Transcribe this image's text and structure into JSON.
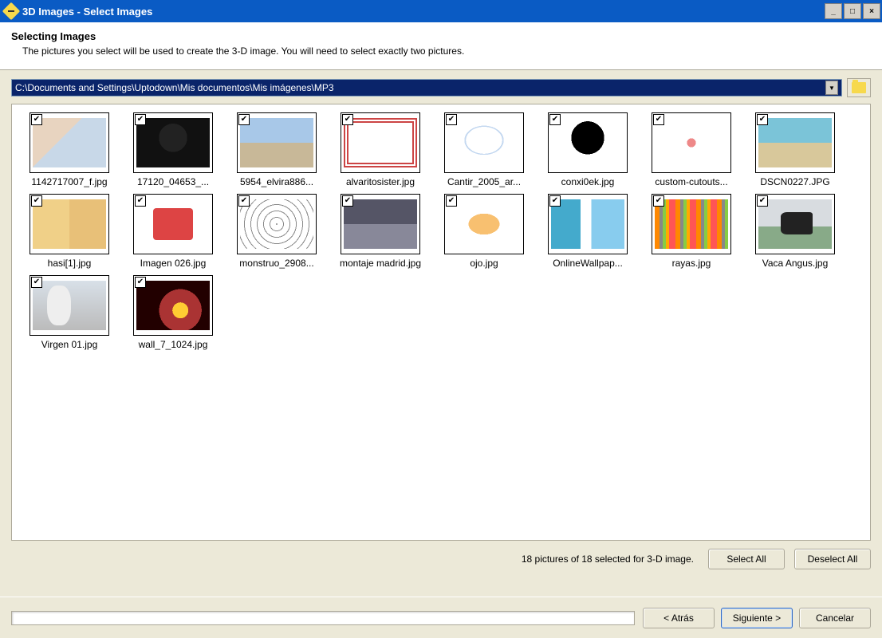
{
  "window": {
    "title": "3D Images - Select Images"
  },
  "header": {
    "title": "Selecting Images",
    "subtitle": "The pictures you select will be used to create the 3-D image. You will need to select exactly two pictures."
  },
  "path": {
    "value": "C:\\Documents and Settings\\Uptodown\\Mis documentos\\Mis imágenes\\MP3"
  },
  "thumbnails": [
    {
      "name": "1142717007_f.jpg",
      "checked": true
    },
    {
      "name": "17120_04653_...",
      "checked": true
    },
    {
      "name": "5954_elvira886...",
      "checked": true
    },
    {
      "name": "alvaritosister.jpg",
      "checked": true
    },
    {
      "name": "Cantir_2005_ar...",
      "checked": true
    },
    {
      "name": "conxi0ek.jpg",
      "checked": true
    },
    {
      "name": "custom-cutouts...",
      "checked": true
    },
    {
      "name": "DSCN0227.JPG",
      "checked": true
    },
    {
      "name": "hasi[1].jpg",
      "checked": true
    },
    {
      "name": "Imagen 026.jpg",
      "checked": true
    },
    {
      "name": "monstruo_2908...",
      "checked": true
    },
    {
      "name": "montaje madrid.jpg",
      "checked": true
    },
    {
      "name": "ojo.jpg",
      "checked": true
    },
    {
      "name": "OnlineWallpap...",
      "checked": true
    },
    {
      "name": "rayas.jpg",
      "checked": true
    },
    {
      "name": "Vaca Angus.jpg",
      "checked": true
    },
    {
      "name": "Virgen 01.jpg",
      "checked": true
    },
    {
      "name": "wall_7_1024.jpg",
      "checked": true
    }
  ],
  "status": "18 pictures of 18 selected for 3-D image.",
  "buttons": {
    "select_all": "Select All",
    "deselect_all": "Deselect All",
    "back": "< Atrás",
    "next": "Siguiente >",
    "cancel": "Cancelar"
  }
}
